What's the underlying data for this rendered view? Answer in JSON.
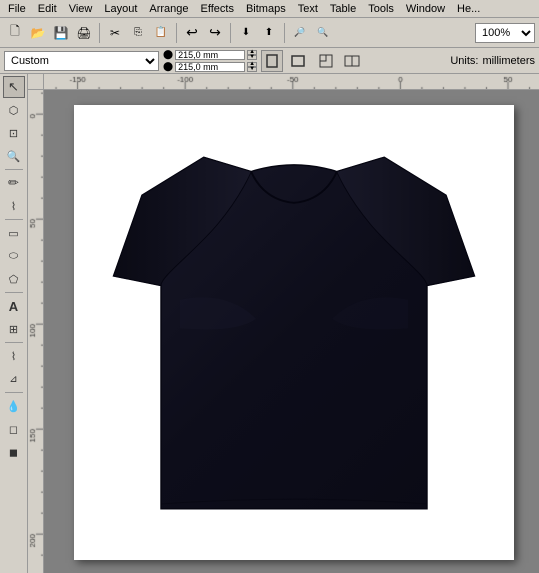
{
  "menu": {
    "items": [
      "File",
      "Edit",
      "View",
      "Layout",
      "Arrange",
      "Effects",
      "Bitmaps",
      "Text",
      "Table",
      "Tools",
      "Window",
      "He..."
    ]
  },
  "toolbar": {
    "buttons": [
      {
        "name": "new",
        "icon": "🗋"
      },
      {
        "name": "open",
        "icon": "📁"
      },
      {
        "name": "save",
        "icon": "💾"
      },
      {
        "name": "print",
        "icon": "🖨"
      },
      {
        "name": "cut",
        "icon": "✂"
      },
      {
        "name": "copy",
        "icon": "⎘"
      },
      {
        "name": "paste",
        "icon": "📋"
      },
      {
        "name": "undo",
        "icon": "↩"
      },
      {
        "name": "redo",
        "icon": "↪"
      },
      {
        "name": "import",
        "icon": "⬇"
      },
      {
        "name": "export",
        "icon": "⬆"
      },
      {
        "name": "zoom",
        "icon": "🔍"
      }
    ],
    "zoom_value": "100%"
  },
  "property_bar": {
    "preset_label": "Custom",
    "width_value": "215,0 mm",
    "height_value": "215,0 mm",
    "units_label": "Units:",
    "units_value": "millimeters"
  },
  "tools": [
    {
      "name": "select",
      "icon": "↖"
    },
    {
      "name": "shape",
      "icon": "⬡"
    },
    {
      "name": "crop",
      "icon": "⊡"
    },
    {
      "name": "zoom-tool",
      "icon": "🔍"
    },
    {
      "name": "freehand",
      "icon": "✏"
    },
    {
      "name": "smart-draw",
      "icon": "⌇"
    },
    {
      "name": "rectangle",
      "icon": "▭"
    },
    {
      "name": "ellipse",
      "icon": "⬭"
    },
    {
      "name": "polygon",
      "icon": "⬠"
    },
    {
      "name": "text-tool",
      "icon": "A"
    },
    {
      "name": "table-tool",
      "icon": "⊞"
    },
    {
      "name": "parallel-dim",
      "icon": "⊿"
    },
    {
      "name": "connector",
      "icon": "⌇"
    },
    {
      "name": "eyedropper",
      "icon": "💧"
    },
    {
      "name": "outline",
      "icon": "⬡"
    },
    {
      "name": "fill",
      "icon": "▪"
    }
  ],
  "canvas": {
    "background_color": "#808080",
    "page_background": "#ffffff",
    "tshirt_color": "#0d0d1a"
  },
  "ruler": {
    "h_labels": [
      "-150",
      "-100",
      "-50",
      "0",
      "50"
    ],
    "v_labels": [
      "200",
      "150",
      "100",
      "50"
    ]
  }
}
